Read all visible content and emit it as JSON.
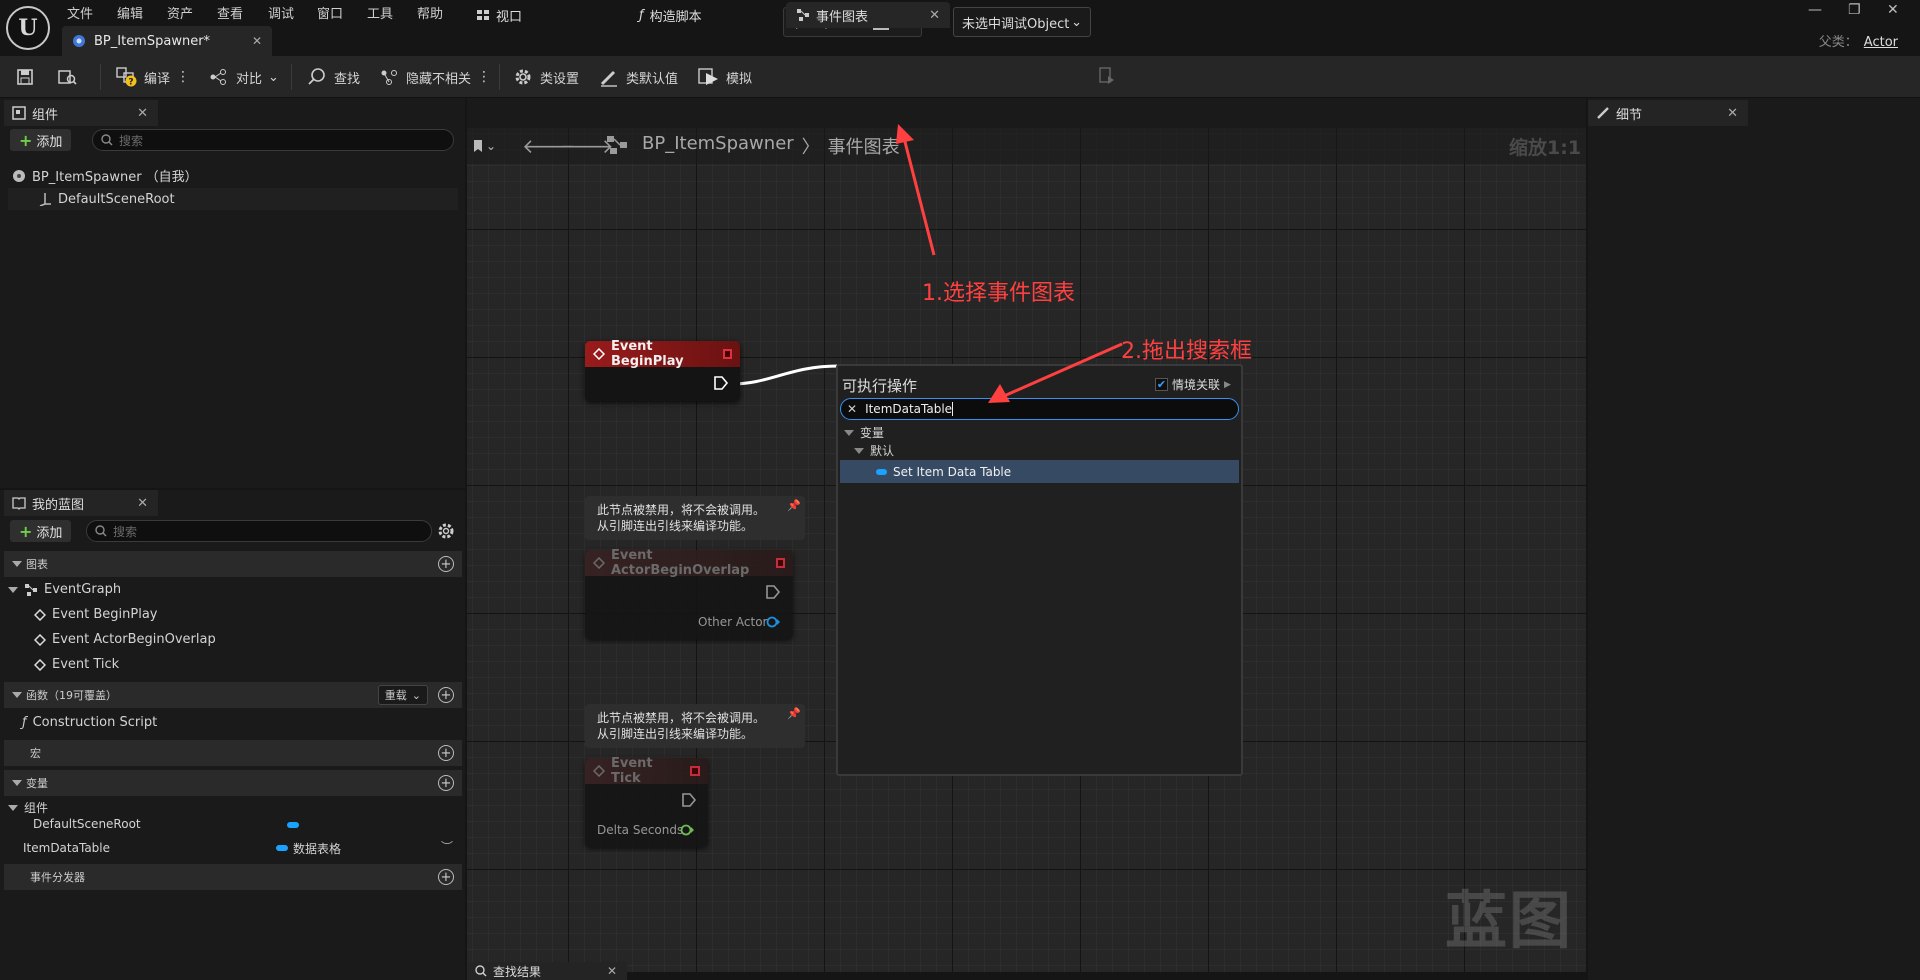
{
  "menu": [
    "文件",
    "编辑",
    "资产",
    "查看",
    "调试",
    "窗口",
    "工具",
    "帮助"
  ],
  "document_tab": {
    "title": "BP_ItemSpawner*"
  },
  "parent_class": {
    "label": "父类：",
    "value": "Actor"
  },
  "toolbar": {
    "compile": "编译",
    "diff": "对比",
    "find": "查找",
    "hide_unrelated": "隐藏不相关",
    "class_settings": "类设置",
    "class_defaults": "类默认值",
    "simulate": "模拟",
    "debug_object": "未选中调试Object"
  },
  "components_panel": {
    "tab": "组件",
    "add": "添加",
    "search_placeholder": "搜索",
    "root": "BP_ItemSpawner （自我）",
    "child": "DefaultSceneRoot"
  },
  "my_blueprint": {
    "tab": "我的蓝图",
    "add": "添加",
    "search_placeholder": "搜索",
    "graphs_header": "图表",
    "event_graph": "EventGraph",
    "events": [
      "Event BeginPlay",
      "Event ActorBeginOverlap",
      "Event Tick"
    ],
    "functions_header": "函数（19可覆盖）",
    "override": "重载",
    "construction_script": "Construction Script",
    "macros_header": "宏",
    "variables_header": "变量",
    "components_group": "组件",
    "var_default_scene_root": "DefaultSceneRoot",
    "var_item_data_table": "ItemDataTable",
    "var_item_data_table_type": "数据表格",
    "dispatchers_header": "事件分发器"
  },
  "graph_tabs": [
    "视口",
    "构造脚本",
    "事件图表"
  ],
  "breadcrumb": {
    "blueprint": "BP_ItemSpawner",
    "graph": "事件图表",
    "zoom": "缩放1:1"
  },
  "nodes": {
    "begin_play": "Event BeginPlay",
    "actor_overlap": "Event ActorBeginOverlap",
    "actor_overlap_pin": "Other Actor",
    "tick": "Event Tick",
    "tick_pin": "Delta Seconds",
    "disabled_note_line1": "此节点被禁用，将不会被调用。",
    "disabled_note_line2": "从引脚连出引线来编译功能。"
  },
  "action_popup": {
    "title": "可执行操作",
    "context": "情境关联",
    "search_value": "ItemDataTable",
    "category": "变量",
    "subcategory": "默认",
    "result": "Set Item Data Table"
  },
  "annotations": {
    "step1": "1.选择事件图表",
    "step2": "2.拖出搜索框",
    "color": "#ff4040"
  },
  "details_panel": {
    "tab": "细节"
  },
  "find_results": {
    "tab": "查找结果"
  },
  "watermark": "蓝图",
  "colors": {
    "event_header": "#8a1a1a",
    "play_green": "#5bd03a",
    "selection": "#364a63",
    "variable_pin": "#19a3ff"
  }
}
